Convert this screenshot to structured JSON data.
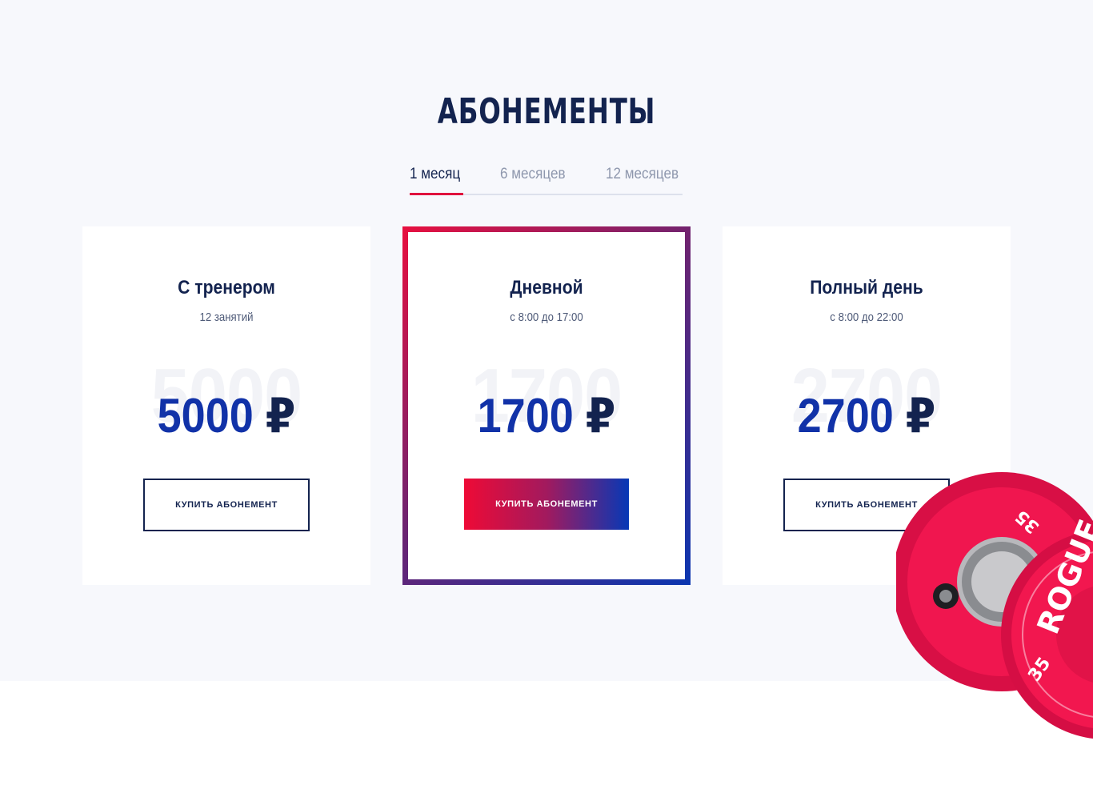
{
  "section": {
    "title": "АБОНЕМЕНТЫ",
    "background": "#f7f8fc"
  },
  "tabs": {
    "items": [
      {
        "label": "1 месяц",
        "active": true
      },
      {
        "label": "6 месяцев",
        "active": false
      },
      {
        "label": "12 месяцев",
        "active": false
      }
    ],
    "indicator_color": "#e0113d"
  },
  "plans": [
    {
      "title": "С тренером",
      "subtitle": "12 занятий",
      "ghost": "5000",
      "amount": "5000",
      "currency": "₽",
      "button": "КУПИТЬ АБОНЕМЕНТ",
      "featured": false
    },
    {
      "title": "Дневной",
      "subtitle": "с 8:00 до 17:00",
      "ghost": "1700",
      "amount": "1700",
      "currency": "₽",
      "button": "КУПИТЬ АБОНЕМЕНТ",
      "featured": true
    },
    {
      "title": "Полный день",
      "subtitle": "с 8:00 до 22:00",
      "ghost": "2700",
      "amount": "2700",
      "currency": "₽",
      "button": "КУПИТЬ АБОНЕМЕНТ",
      "featured": false
    }
  ],
  "decoration": {
    "plate_brand": "ROGUE",
    "plate_weight": "35",
    "plate_color": "#f0164f"
  },
  "colors": {
    "title": "#13234f",
    "price": "#1132a8",
    "accent_red": "#ee0a36",
    "accent_blue": "#0638b6"
  }
}
